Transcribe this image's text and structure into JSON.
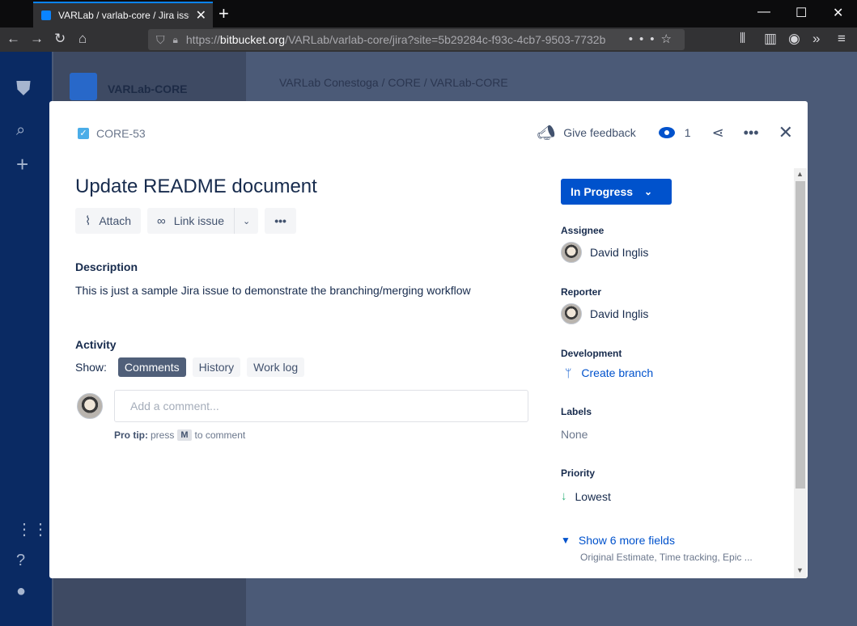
{
  "browser": {
    "tab_title": "VARLab / varlab-core / Jira issue",
    "url_host": "bitbucket.org",
    "url_prefix": "https://",
    "url_path": "/VARLab/varlab-core/jira?site=5b29284c-f93c-4cb7-9503-7732b"
  },
  "background": {
    "project_name": "VARLab-CORE",
    "breadcrumb": "VARLab Conestoga  /  CORE  /  VARLab-CORE"
  },
  "issue": {
    "key": "CORE-53",
    "title": "Update README document",
    "give_feedback": "Give feedback",
    "watchers": "1",
    "attach_label": "Attach",
    "link_issue_label": "Link issue",
    "description_heading": "Description",
    "description": "This is just a sample Jira issue to demonstrate the branching/merging workflow",
    "activity_heading": "Activity",
    "show_label": "Show:",
    "activity_tabs": [
      "Comments",
      "History",
      "Work log"
    ],
    "comment_placeholder": "Add a comment...",
    "protip_bold": "Pro tip:",
    "protip_press": "press",
    "protip_key": "M",
    "protip_end": "to comment"
  },
  "fields": {
    "status": "In Progress",
    "assignee_label": "Assignee",
    "assignee": "David Inglis",
    "reporter_label": "Reporter",
    "reporter": "David Inglis",
    "development_label": "Development",
    "create_branch": "Create branch",
    "labels_label": "Labels",
    "labels": "None",
    "priority_label": "Priority",
    "priority": "Lowest",
    "show_more": "Show 6 more fields",
    "more_hint": "Original Estimate, Time tracking, Epic ..."
  }
}
